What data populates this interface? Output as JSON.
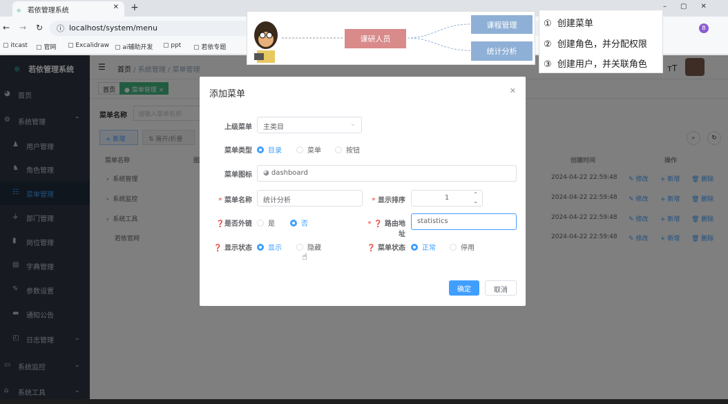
{
  "browser": {
    "tab_title": "若依管理系统",
    "url": "localhost/system/menu",
    "bookmarks": [
      "itcast",
      "官网",
      "Excalidraw",
      "ai辅助开发",
      "ppt",
      "若依专题"
    ],
    "profile_initial": "B"
  },
  "app": {
    "logo_title": "若依管理系统",
    "breadcrumb": [
      "首页",
      "系统管理",
      "菜单管理"
    ],
    "tags": [
      "首页",
      "菜单管理"
    ]
  },
  "sidebar": {
    "items": [
      {
        "label": "首页",
        "icon": "dashboard-icon"
      },
      {
        "label": "系统管理",
        "icon": "gear-icon"
      },
      {
        "label": "用户管理",
        "icon": "user-icon"
      },
      {
        "label": "角色管理",
        "icon": "peoples-icon"
      },
      {
        "label": "菜单管理",
        "icon": "tree-table-icon"
      },
      {
        "label": "部门管理",
        "icon": "tree-icon"
      },
      {
        "label": "岗位管理",
        "icon": "post-icon"
      },
      {
        "label": "字典管理",
        "icon": "dict-icon"
      },
      {
        "label": "参数设置",
        "icon": "edit-icon"
      },
      {
        "label": "通知公告",
        "icon": "message-icon"
      },
      {
        "label": "日志管理",
        "icon": "log-icon"
      },
      {
        "label": "系统监控",
        "icon": "monitor-icon"
      },
      {
        "label": "系统工具",
        "icon": "tool-icon"
      }
    ]
  },
  "search": {
    "label": "菜单名称",
    "placeholder": "请输入菜单名称"
  },
  "toolbar": {
    "add": "+ 新增",
    "expand": "⇅ 展开/折叠"
  },
  "table": {
    "headers": [
      "菜单名称",
      "图标",
      "创建时间",
      "操作"
    ],
    "rows": [
      {
        "name": "系统管理",
        "time": "2024-04-22 22:59:48"
      },
      {
        "name": "系统监控",
        "time": "2024-04-22 22:59:48"
      },
      {
        "name": "系统工具",
        "time": "2024-04-22 22:59:48"
      },
      {
        "name": "若依官网",
        "time": "2024-04-22 22:59:48"
      }
    ],
    "ops": [
      "修改",
      "+ 新增",
      "删除"
    ]
  },
  "dialog": {
    "title": "添加菜单",
    "parent_label": "上级菜单",
    "parent_value": "主类目",
    "type_label": "菜单类型",
    "type_options": [
      "目录",
      "菜单",
      "按钮"
    ],
    "icon_label": "菜单图标",
    "icon_value": "dashboard",
    "name_label": "菜单名称",
    "name_value": "统计分析",
    "order_label": "显示排序",
    "order_value": "1",
    "external_label": "是否外链",
    "external_options": [
      "是",
      "否"
    ],
    "route_label": "路由地址",
    "route_value": "statistics",
    "visible_label": "显示状态",
    "visible_options": [
      "显示",
      "隐藏"
    ],
    "status_label": "菜单状态",
    "status_options": [
      "正常",
      "停用"
    ],
    "confirm": "确定",
    "cancel": "取消"
  },
  "diagram": {
    "role": "课研人员",
    "menu1": "课程管理",
    "menu2": "统计分析"
  },
  "steps": [
    {
      "num": "①",
      "text": "创建菜单"
    },
    {
      "num": "②",
      "text": "创建角色，并分配权限"
    },
    {
      "num": "③",
      "text": "创建用户，并关联角色"
    }
  ],
  "colors": {
    "primary": "#409eff",
    "sidebar": "#2e3541",
    "role_box": "#d98a8a",
    "menu_box": "#8fb0d6"
  }
}
